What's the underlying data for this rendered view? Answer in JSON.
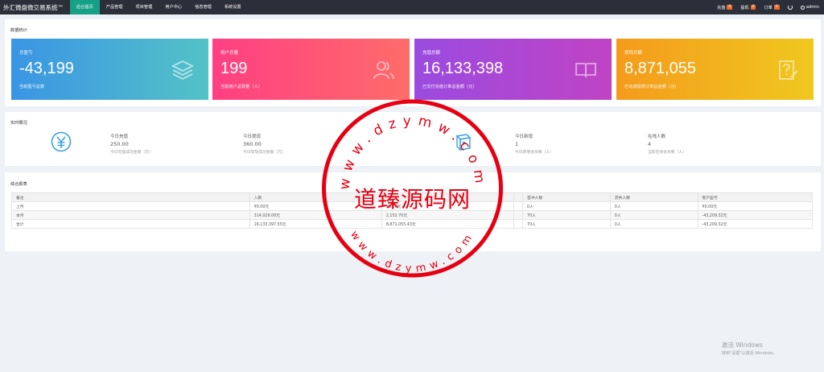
{
  "header": {
    "brand": "外汇微盘微交易系统™",
    "nav": [
      {
        "label": "后台首页",
        "active": true
      },
      {
        "label": "产品管理",
        "active": false
      },
      {
        "label": "项目管理",
        "active": false
      },
      {
        "label": "用户中心",
        "active": false
      },
      {
        "label": "信息管理",
        "active": false
      },
      {
        "label": "系统设置",
        "active": false
      }
    ],
    "right": {
      "recharge_label": "充值",
      "recharge_count": "0",
      "withdraw_label": "提现",
      "withdraw_count": "0",
      "order_label": "订单",
      "order_count": "0",
      "user_label": "admin",
      "refresh_icon": "refresh-icon",
      "user_icon": "user-icon"
    }
  },
  "stats": {
    "title": "数据统计",
    "cards": [
      {
        "label": "总盈亏",
        "value": "-43,199",
        "desc": "当前盈亏总数",
        "color": "#3fa0dc",
        "icon": "layers-icon"
      },
      {
        "label": "用户总量",
        "value": "199",
        "desc": "当前用户总数量（人）",
        "color": "#fd4a77",
        "icon": "users-icon"
      },
      {
        "label": "充值总额",
        "value": "16,133,398",
        "desc": "已支付充值订单总金额（元）",
        "color": "#a748d3",
        "icon": "book-icon"
      },
      {
        "label": "提现总额",
        "value": "8,871,055",
        "desc": "已完成提现订单总金额（元）",
        "color": "#f1a81d",
        "icon": "question-doc-icon"
      }
    ]
  },
  "realtime": {
    "title": "实时概况",
    "items": [
      {
        "label": "今日充值",
        "value": "250.00",
        "desc": "今日充值成功金额（元）"
      },
      {
        "label": "今日提现",
        "value": "360.00",
        "desc": "今日提现成功金额（元）"
      },
      {
        "label": "今日新增",
        "value": "1",
        "desc": "今日新增会员数（人）"
      },
      {
        "label": "在线人数",
        "value": "4",
        "desc": "当前在线会员数（人）"
      }
    ],
    "icons": [
      "yuan-icon",
      "cube-icon"
    ]
  },
  "report": {
    "title": "综合报表",
    "columns": [
      "备注",
      "入款",
      "",
      "",
      "首冲人数",
      "流失人数",
      "客户盈亏"
    ],
    "rows": [
      [
        "上月",
        "¥0.00元",
        "¥0.00元",
        "",
        "0人",
        "0人",
        "¥0.00元"
      ],
      [
        "本月",
        "314,029.00元",
        "2,152.70元",
        "",
        "70人",
        "0人",
        "-43,209.32元"
      ],
      [
        "合计",
        "16,133,397.55元",
        "8,871,055.43元",
        "",
        "70人",
        "0人",
        "-43,209.32元"
      ]
    ]
  },
  "watermark": {
    "center_text": "道臻源码网",
    "ring_top": "www.dzymw.com",
    "ring_bottom": "www.dzymw.com",
    "color": "#e60012"
  },
  "system": {
    "activate_title": "激活 Windows",
    "activate_sub": "转到\"设置\"以激活 Windows。"
  }
}
